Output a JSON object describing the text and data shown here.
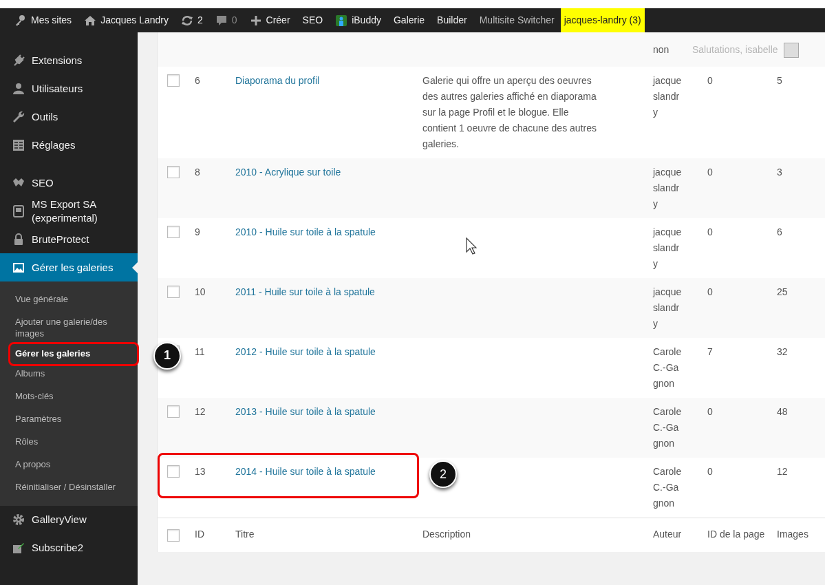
{
  "admin_bar": {
    "items": [
      {
        "label": "Mes sites"
      },
      {
        "label": "Jacques Landry"
      },
      {
        "label": "2"
      },
      {
        "label": "0",
        "disabled": true
      },
      {
        "label": "Créer"
      },
      {
        "label": "SEO"
      },
      {
        "label": "iBuddy"
      },
      {
        "label": "Galerie"
      },
      {
        "label": "Builder"
      },
      {
        "label": "Multisite Switcher",
        "dim": true
      },
      {
        "label": "jacques-landry (3)",
        "highlight": true
      }
    ]
  },
  "sidebar": {
    "items": [
      {
        "label": "Extensions",
        "selected": false
      },
      {
        "label": "Utilisateurs",
        "selected": false
      },
      {
        "label": "Outils",
        "selected": false
      },
      {
        "label": "Réglages",
        "selected": false,
        "separator_after": true
      },
      {
        "label": "SEO",
        "selected": false
      },
      {
        "label": "MS Export SA (experimental)",
        "selected": false
      },
      {
        "label": "BruteProtect",
        "selected": false
      },
      {
        "label": "Gérer les galeries",
        "selected": true,
        "children": [
          {
            "label": "Vue générale",
            "selected": false
          },
          {
            "label": "Ajouter une galerie/des images",
            "selected": false
          },
          {
            "label": "Gérer les galeries",
            "selected": true,
            "highlighted": true,
            "callout": "1"
          },
          {
            "label": "Albums",
            "selected": false
          },
          {
            "label": "Mots-clés",
            "selected": false
          },
          {
            "label": "Paramètres",
            "selected": false
          },
          {
            "label": "Rôles",
            "selected": false
          },
          {
            "label": "A propos",
            "selected": false
          },
          {
            "label": "Réinitialiser / Désinstaller",
            "selected": false
          }
        ]
      },
      {
        "label": "GalleryView",
        "selected": false
      },
      {
        "label": "Subscribe2",
        "selected": false
      }
    ]
  },
  "header_partial": {
    "author": "non",
    "greeting": "Salutations, isabelle"
  },
  "table": {
    "columns": [
      "ID",
      "Titre",
      "Description",
      "Auteur",
      "ID de la page",
      "Images"
    ],
    "rows": [
      {
        "checked": false,
        "id": "6",
        "title": "Diaporama du profil",
        "description": "Galerie qui offre un aperçu des oeuvres des autres galeries affiché en diaporama sur la page Profil et le blogue. Elle contient 1 oeuvre de chacune des autres galeries.",
        "author": "jacqueslandry",
        "page_id": "0",
        "images": "5"
      },
      {
        "checked": false,
        "id": "8",
        "title": "2010 - Acrylique sur toile",
        "author": "jacqueslandry",
        "page_id": "0",
        "images": "3"
      },
      {
        "checked": false,
        "id": "9",
        "title": "2010 - Huile sur toile à la spatule",
        "author": "jacqueslandry",
        "page_id": "0",
        "images": "6"
      },
      {
        "checked": false,
        "id": "10",
        "title": "2011 - Huile sur toile à la spatule",
        "author": "jacqueslandry",
        "page_id": "0",
        "images": "25"
      },
      {
        "checked": false,
        "id": "11",
        "title": "2012 - Huile sur toile à la spatule",
        "author": "Carole C.-Gagnon",
        "page_id": "7",
        "images": "32"
      },
      {
        "checked": false,
        "id": "12",
        "title": "2013 - Huile sur toile à la spatule",
        "author": "Carole C.-Gagnon",
        "page_id": "0",
        "images": "48"
      },
      {
        "checked": false,
        "id": "13",
        "title": "2014 - Huile sur toile à la spatule",
        "author": "Carole C.-Gagnon",
        "page_id": "0",
        "images": "12",
        "highlighted": true,
        "callout": "2"
      }
    ],
    "footer_checked": false
  }
}
